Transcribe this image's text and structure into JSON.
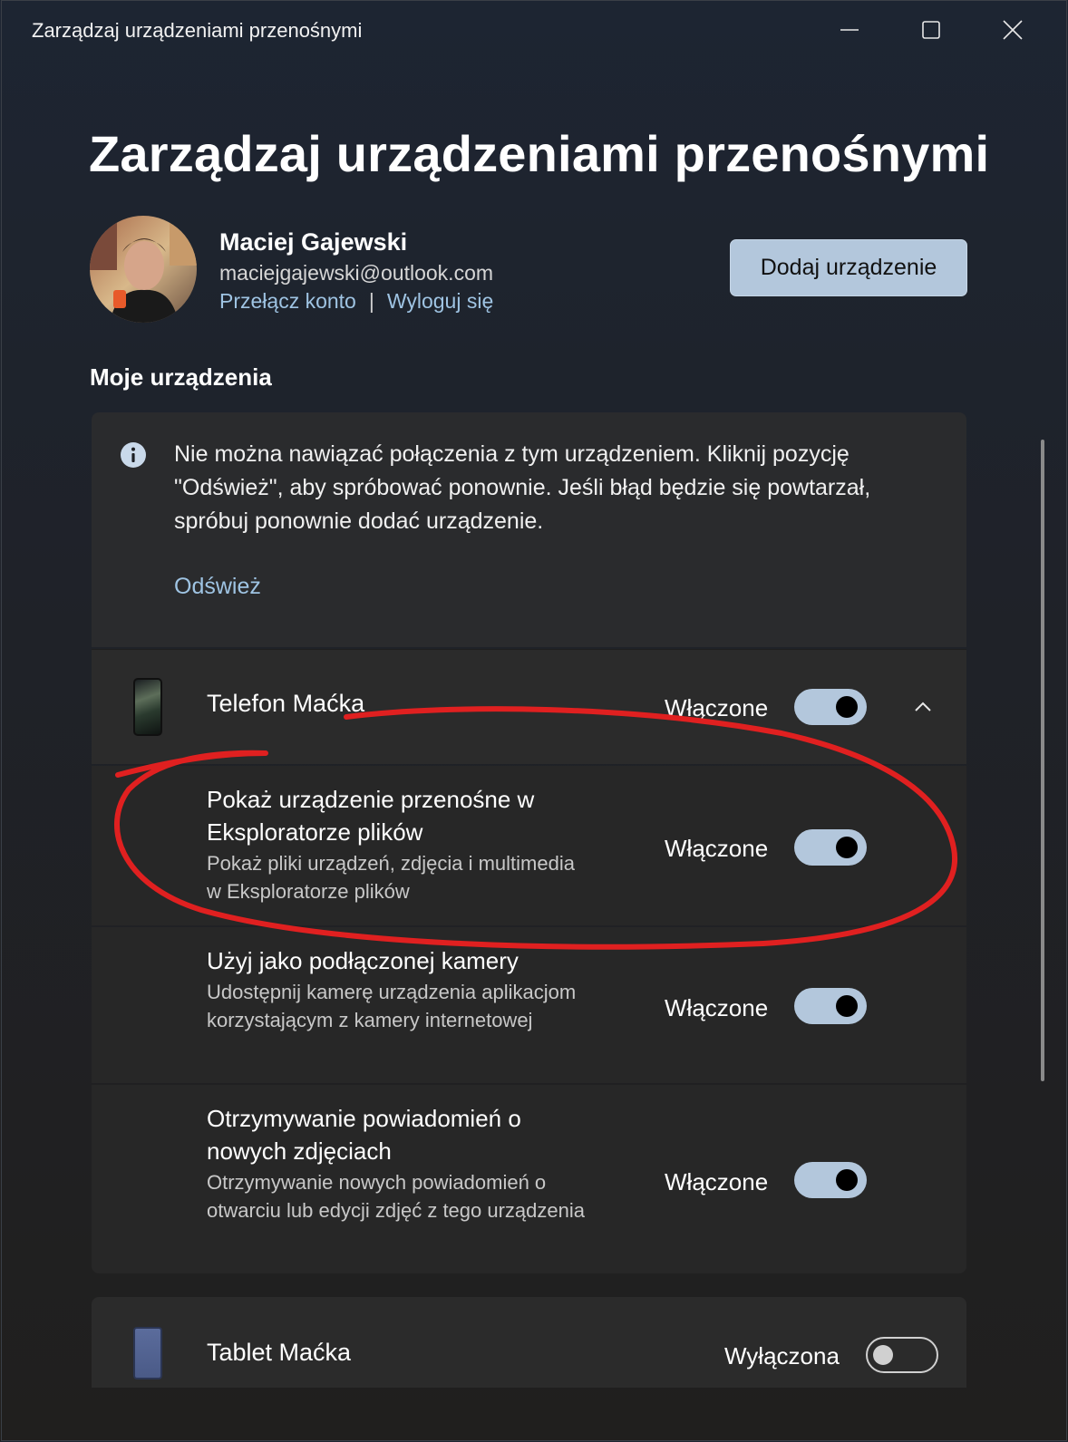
{
  "window": {
    "title": "Zarządzaj urządzeniami przenośnymi"
  },
  "page": {
    "title": "Zarządzaj urządzeniami przenośnymi"
  },
  "account": {
    "name": "Maciej Gajewski",
    "email": "maciejgajewski@outlook.com",
    "switch_label": "Przełącz konto",
    "separator": "|",
    "signout_label": "Wyloguj się"
  },
  "actions": {
    "add_device_label": "Dodaj urządzenie"
  },
  "section": {
    "my_devices": "Moje urządzenia"
  },
  "info_banner": {
    "message": "Nie można nawiązać połączenia z tym urządzeniem. Kliknij pozycję \"Odśwież\", aby spróbować ponownie. Jeśli błąd będzie się powtarzał, spróbuj ponownie dodać urządzenie.",
    "refresh_label": "Odśwież"
  },
  "devices": [
    {
      "name": "Telefon Maćka",
      "state_label": "Włączone",
      "enabled": true,
      "expanded": true,
      "options": [
        {
          "title": "Pokaż urządzenie przenośne w Eksploratorze plików",
          "description": "Pokaż pliki urządzeń, zdjęcia i multimedia w Eksploratorze plików",
          "state_label": "Włączone",
          "enabled": true
        },
        {
          "title": "Użyj jako podłączonej kamery",
          "description": "Udostępnij kamerę urządzenia aplikacjom korzystającym z kamery internetowej",
          "state_label": "Włączone",
          "enabled": true
        },
        {
          "title": "Otrzymywanie powiadomień o nowych zdjęciach",
          "description": "Otrzymywanie nowych powiadomień o otwarciu lub edycji zdjęć z tego urządzenia",
          "state_label": "Włączone",
          "enabled": true
        }
      ]
    },
    {
      "name": "Tablet Maćka",
      "state_label": "Wyłączona",
      "enabled": false
    }
  ],
  "colors": {
    "accent": "#b3c7dc",
    "link": "#9fc4e3",
    "annotation": "#e02020"
  },
  "icons": {
    "minimize": "minimize-icon",
    "maximize": "maximize-icon",
    "close": "close-icon",
    "info": "info-icon",
    "chevron": "chevron-up-icon"
  }
}
